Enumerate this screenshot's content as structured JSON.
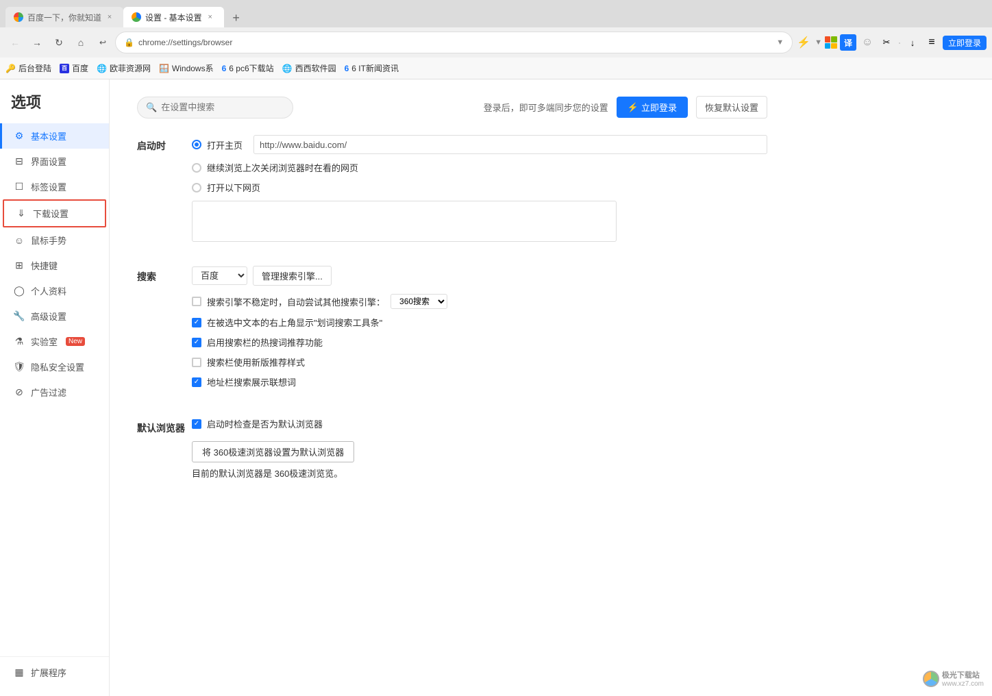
{
  "browser": {
    "tab1": {
      "title": "百度一下，你就知道",
      "active": false,
      "favicon": "baidu"
    },
    "tab2": {
      "title": "设置 - 基本设置",
      "active": true,
      "favicon": "settings"
    },
    "tab_add_label": "+",
    "address": "chrome://settings/browser",
    "back_btn": "←",
    "forward_btn": "→",
    "refresh_btn": "↻",
    "home_btn": "⌂",
    "restore_btn": "↺"
  },
  "bookmarks": [
    {
      "label": "后台登陆"
    },
    {
      "label": "百度"
    },
    {
      "label": "欧菲资源网"
    },
    {
      "label": "Windows系"
    },
    {
      "label": "6 pc6下载站"
    },
    {
      "label": "西西软件园"
    },
    {
      "label": "6 IT新闻资讯"
    }
  ],
  "sidebar": {
    "title": "选项",
    "search_placeholder": "在设置中搜索",
    "items": [
      {
        "id": "basic",
        "label": "基本设置",
        "active": true,
        "icon": "⚙"
      },
      {
        "id": "interface",
        "label": "界面设置",
        "active": false,
        "icon": "🖥"
      },
      {
        "id": "tabs",
        "label": "标签设置",
        "active": false,
        "icon": "▣"
      },
      {
        "id": "download",
        "label": "下载设置",
        "active": false,
        "icon": "⬇",
        "highlighted": true
      },
      {
        "id": "mouse",
        "label": "鼠标手势",
        "active": false,
        "icon": "✋"
      },
      {
        "id": "shortcut",
        "label": "快捷键",
        "active": false,
        "icon": "⌨"
      },
      {
        "id": "profile",
        "label": "个人资料",
        "active": false,
        "icon": "👤"
      },
      {
        "id": "advanced",
        "label": "高级设置",
        "active": false,
        "icon": "🔧"
      },
      {
        "id": "lab",
        "label": "实验室",
        "active": false,
        "icon": "🧪",
        "badge": "New"
      },
      {
        "id": "privacy",
        "label": "隐私安全设置",
        "active": false,
        "icon": "🛡"
      },
      {
        "id": "adblock",
        "label": "广告过滤",
        "active": false,
        "icon": "🚫"
      }
    ],
    "bottom_items": [
      {
        "id": "extensions",
        "label": "扩展程序",
        "icon": "▦"
      }
    ]
  },
  "header": {
    "login_tip": "登录后，即可多端同步您的设置",
    "login_btn": "立即登录",
    "login_icon": "⚡",
    "restore_btn": "恢复默认设置"
  },
  "startup_section": {
    "label": "启动时",
    "options": [
      {
        "id": "open_home",
        "label": "打开主页",
        "checked": true,
        "has_url": true,
        "url": "http://www.baidu.com/"
      },
      {
        "id": "continue",
        "label": "继续浏览上次关闭浏览器时在看的网页",
        "checked": false
      },
      {
        "id": "open_urls",
        "label": "打开以下网页",
        "checked": false
      }
    ],
    "textarea_placeholder": ""
  },
  "search_section": {
    "label": "搜索",
    "engine": "百度",
    "manage_btn": "管理搜索引擎...",
    "options": [
      {
        "id": "fallback",
        "checked": false,
        "label": "搜索引擎不稳定时，自动尝试其他搜索引擎：",
        "dropdown": "360搜索",
        "has_dropdown": true
      },
      {
        "id": "search_tool",
        "checked": true,
        "label": "在被选中文本的右上角显示\"划词搜索工具条\""
      },
      {
        "id": "hot_search",
        "checked": true,
        "label": "启用搜索栏的热搜词推荐功能"
      },
      {
        "id": "new_style",
        "checked": false,
        "label": "搜索栏使用新版推荐样式"
      },
      {
        "id": "suggest",
        "checked": true,
        "label": "地址栏搜索展示联想词"
      }
    ]
  },
  "default_browser_section": {
    "label": "默认浏览器",
    "check_option": {
      "checked": true,
      "label": "启动时检查是否为默认浏览器"
    },
    "set_default_btn": "将 360极速浏览器设置为默认浏览器",
    "status_text": "目前的默认浏览器是 360极速浏览览。"
  },
  "watermark": {
    "logo": "极光下载站",
    "url": "www.xz7.com"
  },
  "toolbar_login_btn": "立即登录"
}
